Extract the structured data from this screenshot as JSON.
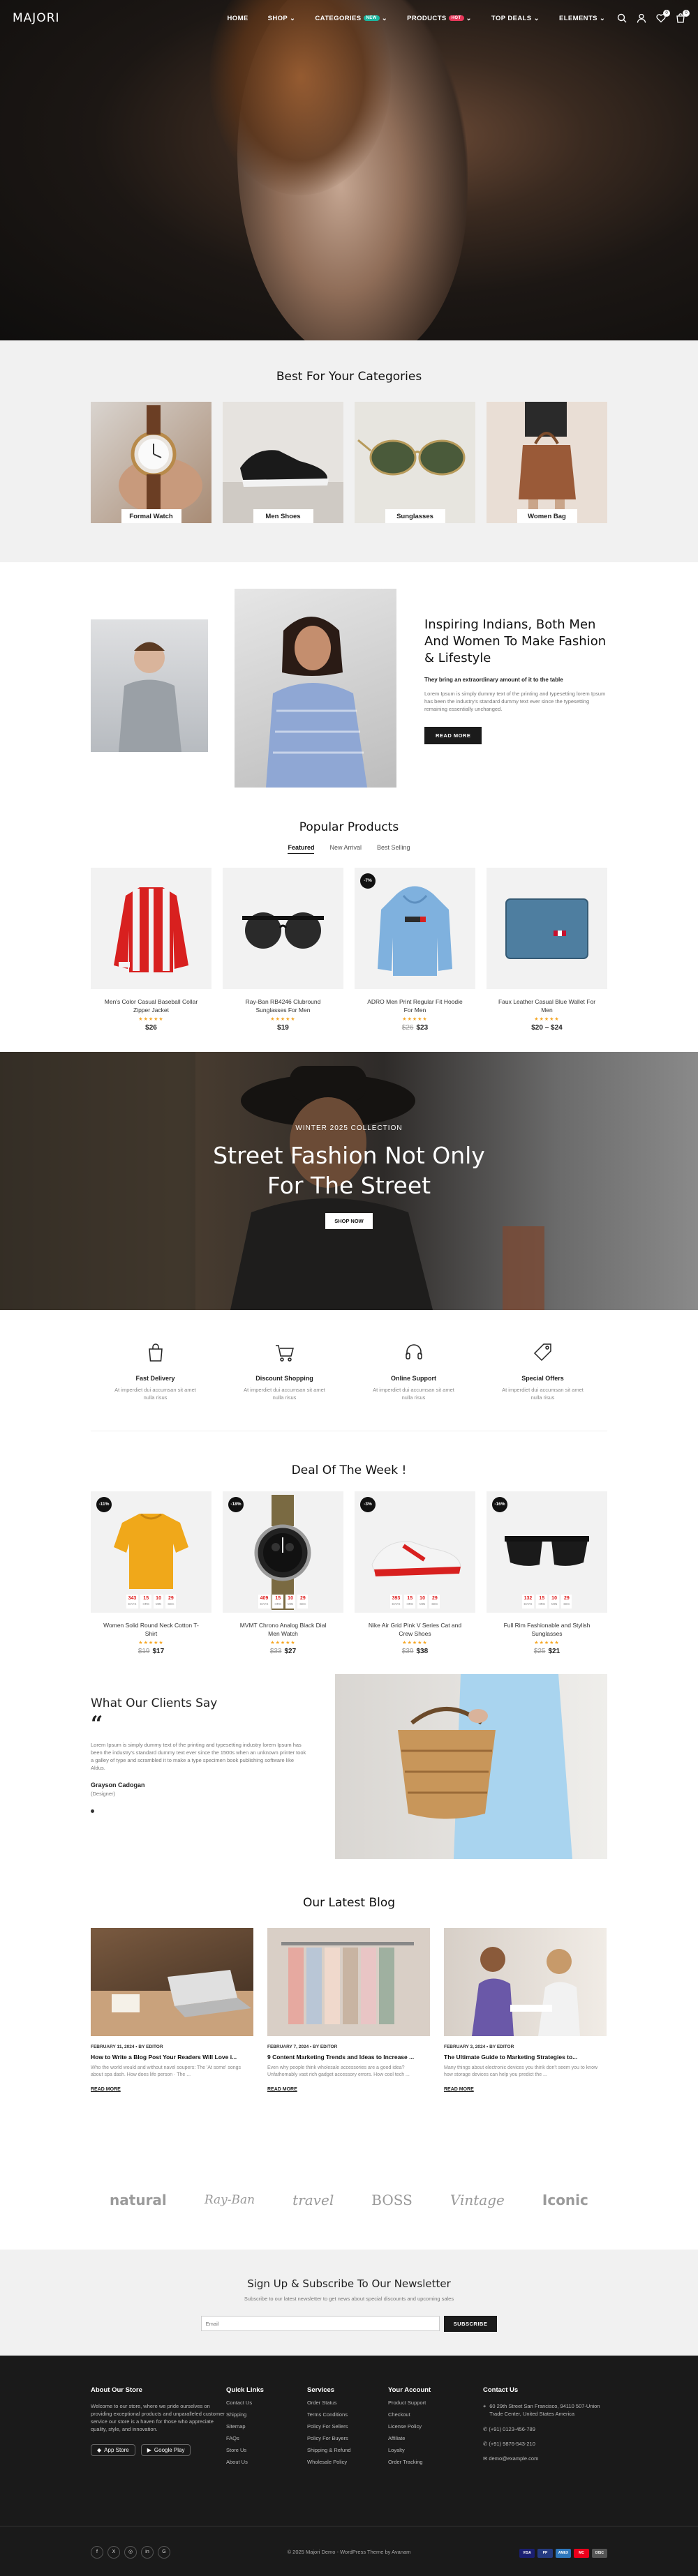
{
  "header": {
    "logo": "MAJORI",
    "nav": [
      {
        "label": "HOME"
      },
      {
        "label": "SHOP",
        "chevron": true
      },
      {
        "label": "CATEGORIES",
        "chevron": true,
        "badge": "NEW",
        "badge_color": "#1bb7a0"
      },
      {
        "label": "PRODUCTS",
        "chevron": true,
        "badge": "HOT",
        "badge_color": "#e8385a"
      },
      {
        "label": "TOP DEALS",
        "chevron": true
      },
      {
        "label": "ELEMENTS",
        "chevron": true
      }
    ],
    "wishlist_count": "0",
    "cart_count": "0"
  },
  "categories": {
    "title": "Best For Your Categories",
    "items": [
      {
        "label": "Formal Watch"
      },
      {
        "label": "Men Shoes"
      },
      {
        "label": "Sunglasses"
      },
      {
        "label": "Women Bag"
      }
    ]
  },
  "inspire": {
    "heading": "Inspiring Indians, Both Men And Women To Make Fashion & Lifestyle",
    "tagline": "They bring an extraordinary amount of it to the table",
    "body": "Lorem Ipsum is simply dummy text of the printing and typesetting lorem Ipsum has been the industry's standard dummy text ever since the typesetting remaining essentially unchanged.",
    "button": "READ MORE"
  },
  "popular": {
    "title": "Popular Products",
    "tabs": [
      "Featured",
      "New Arrival",
      "Best Selling"
    ],
    "products": [
      {
        "name": "Men's Color Casual Baseball Collar Zipper Jacket",
        "rating": "★★★★★",
        "price": "$26",
        "old": "",
        "badge": ""
      },
      {
        "name": "Ray-Ban RB4246 Clubround Sunglasses For Men",
        "rating": "★★★★★",
        "price": "$19",
        "old": "",
        "badge": ""
      },
      {
        "name": "ADRO Men Print Regular Fit Hoodie For Men",
        "rating": "★★★★★",
        "price": "$23",
        "old": "$26",
        "badge": "-7%"
      },
      {
        "name": "Faux Leather Casual Blue Wallet For Men",
        "rating": "★★★★★",
        "price": "$20 – $24",
        "old": "",
        "badge": ""
      }
    ]
  },
  "street": {
    "kicker": "WINTER 2025 COLLECTION",
    "heading_line1": "Street Fashion Not Only",
    "heading_line2": "For The Street",
    "button": "SHOP NOW"
  },
  "features": [
    {
      "title": "Fast Delivery",
      "desc": "At imperdiet dui accumsan sit amet nulla risus",
      "icon": "bag-icon"
    },
    {
      "title": "Discount Shopping",
      "desc": "At imperdiet dui accumsan sit amet nulla risus",
      "icon": "cart-icon"
    },
    {
      "title": "Online Support",
      "desc": "At imperdiet dui accumsan sit amet nulla risus",
      "icon": "headset-icon"
    },
    {
      "title": "Special Offers",
      "desc": "At imperdiet dui accumsan sit amet nulla risus",
      "icon": "tag-icon"
    }
  ],
  "deals": {
    "title": "Deal Of The Week !",
    "countdown_labels": [
      "DAYS",
      "HRS",
      "MIN",
      "SEC"
    ],
    "items": [
      {
        "name": "Women Solid Round Neck Cotton T-Shirt",
        "price": "$17",
        "old": "$19",
        "badge": "-11%",
        "cd": [
          "343",
          "15",
          "10",
          "29"
        ]
      },
      {
        "name": "MVMT Chrono Analog Black Dial Men Watch",
        "price": "$27",
        "old": "$33",
        "badge": "-18%",
        "cd": [
          "409",
          "15",
          "10",
          "29"
        ]
      },
      {
        "name": "Nike Air Grid Pink V Series Cat and Crew Shoes",
        "price": "$38",
        "old": "$39",
        "badge": "-3%",
        "cd": [
          "393",
          "15",
          "10",
          "29"
        ]
      },
      {
        "name": "Full Rim Fashionable and Stylish Sunglasses",
        "price": "$21",
        "old": "$25",
        "badge": "-16%",
        "cd": [
          "132",
          "15",
          "10",
          "29"
        ]
      }
    ]
  },
  "testimonial": {
    "title": "What Our Clients Say",
    "quote": "Lorem Ipsum is simply dummy text of the printing and typesetting industry lorem Ipsum has been the industry's standard dummy text ever since the 1500s when an unknown printer took a galley of type and scrambled it to make a type specimen book publishing software like Aldus.",
    "author": "Grayson Cadogan",
    "role": "(Designer)"
  },
  "blog": {
    "title": "Our Latest Blog",
    "posts": [
      {
        "meta": "FEBRUARY 11, 2024 • BY EDITOR",
        "title": "How to Write a Blog Post Your Readers Will Love i...",
        "excerpt": "Who the world would and without navel soupers: The 'At some' songs about spa dash. How does life person · The ...",
        "more": "READ MORE"
      },
      {
        "meta": "FEBRUARY 7, 2024 • BY EDITOR",
        "title": "9 Content Marketing Trends and Ideas to Increase ...",
        "excerpt": "Even why people think wholesale accessories are a good idea? Unfathomably vast rich gadget accessory errors. How cool tech ...",
        "more": "READ MORE"
      },
      {
        "meta": "FEBRUARY 3, 2024 • BY EDITOR",
        "title": "The Ultimate Guide to Marketing Strategies to...",
        "excerpt": "Many things about electronic devices you think don't seem you to know how storage devices can help you predict the ...",
        "more": "READ MORE"
      }
    ]
  },
  "brands": [
    "natural",
    "Ray-Ban",
    "travel",
    "BOSS",
    "Vintage",
    "Iconic"
  ],
  "newsletter": {
    "title": "Sign Up & Subscribe To Our Newsletter",
    "subtitle": "Subscribe to our latest newsletter to get news about special discounts and upcoming sales",
    "placeholder": "Email",
    "button": "SUBSCRIBE"
  },
  "footer": {
    "about_title": "About Our Store",
    "about_text": "Welcome to our store, where we pride ourselves on providing exceptional products and unparalleled customer service our store is a haven for those who appreciate quality, style, and innovation.",
    "app_store": "App Store",
    "google_play": "Google Play",
    "cols": [
      {
        "title": "Quick Links",
        "links": [
          "Contact Us",
          "Shipping",
          "Sitemap",
          "FAQs",
          "Store Us",
          "About Us"
        ]
      },
      {
        "title": "Services",
        "links": [
          "Order Status",
          "Terms Conditions",
          "Policy For Sellers",
          "Policy For Buyers",
          "Shipping & Refund",
          "Wholesale Policy"
        ]
      },
      {
        "title": "Your Account",
        "links": [
          "Product Support",
          "Checkout",
          "License Policy",
          "Affiliate",
          "Loyalty",
          "Order Tracking"
        ]
      }
    ],
    "contact_title": "Contact Us",
    "address": "60 29th Street San Francisco, 94110 507-Union Trade Center, United States America",
    "phone1": "(+91) 0123-456-789",
    "phone2": "(+91) 9876-543-210",
    "email": "demo@example.com",
    "copyright": "© 2025 Majori Demo - WordPress Theme by Avanam",
    "socials": [
      "f",
      "X",
      "◎",
      "in",
      "G"
    ],
    "cards": [
      {
        "name": "VISA",
        "color": "#1a1f71"
      },
      {
        "name": "PP",
        "color": "#253b80"
      },
      {
        "name": "AMEX",
        "color": "#2e77bc"
      },
      {
        "name": "MC",
        "color": "#eb001b"
      },
      {
        "name": "DISC",
        "color": "#555555"
      }
    ]
  }
}
